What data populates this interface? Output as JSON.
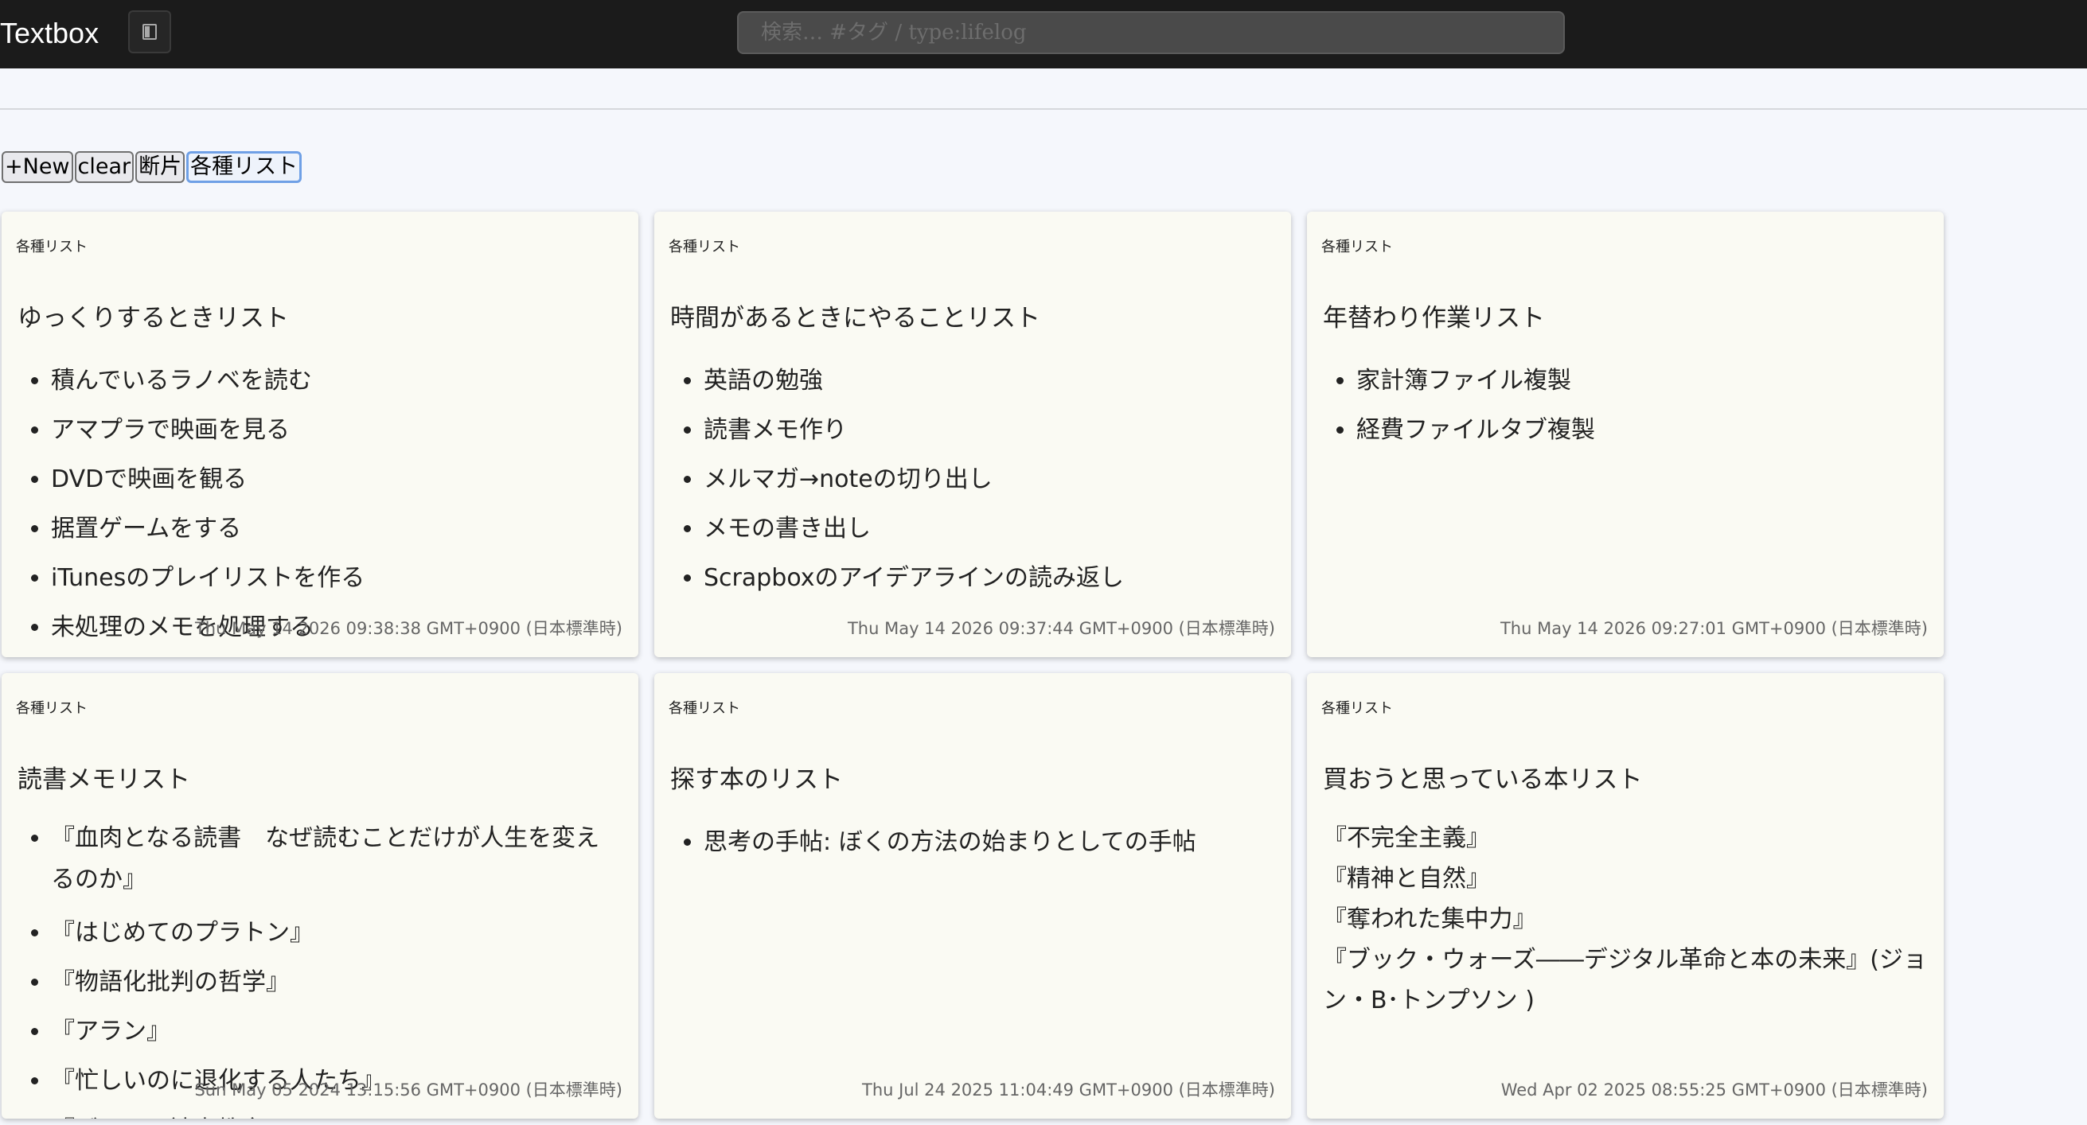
{
  "header": {
    "title": "Textbox",
    "search_placeholder": "検索… #タグ / type:lifelog"
  },
  "toolbar": {
    "new_label": "+New",
    "clear_label": "clear",
    "fragments_label": "断片",
    "lists_label": "各種リスト"
  },
  "cards": [
    {
      "tag": "各種リスト",
      "title": "ゆっくりするときリスト",
      "items": [
        "積んでいるラノベを読む",
        "アマプラで映画を見る",
        "DVDで映画を観る",
        "据置ゲームをする",
        "iTunesのプレイリストを作る",
        "未処理のメモを処理する"
      ],
      "date": "Thu May 14 2026 09:38:38 GMT+0900 (日本標準時)"
    },
    {
      "tag": "各種リスト",
      "title": "時間があるときにやることリスト",
      "items": [
        "英語の勉強",
        "読書メモ作り",
        "メルマガ→noteの切り出し",
        "メモの書き出し",
        "Scrapboxのアイデアラインの読み返し"
      ],
      "date": "Thu May 14 2026 09:37:44 GMT+0900 (日本標準時)"
    },
    {
      "tag": "各種リスト",
      "title": "年替わり作業リスト",
      "items": [
        "家計簿ファイル複製",
        "経費ファイルタブ複製"
      ],
      "date": "Thu May 14 2026 09:27:01 GMT+0900 (日本標準時)"
    },
    {
      "tag": "各種リスト",
      "title": "読書メモリスト",
      "items": [
        "『血肉となる読書　なぜ読むことだけが人生を変えるのか』",
        "『はじめてのプラトン』",
        "『物語化批判の哲学』",
        "『アラン』",
        "『忙しいのに退化する人たち』",
        "『ゾーンと読書教育』"
      ],
      "date": "Sun May 05 2024 13:15:56 GMT+0900 (日本標準時)"
    },
    {
      "tag": "各種リスト",
      "title": "探す本のリスト",
      "items": [
        "思考の手帖: ぼくの方法の始まりとしての手帖"
      ],
      "date": "Thu Jul 24 2025 11:04:49 GMT+0900 (日本標準時)"
    },
    {
      "tag": "各種リスト",
      "title": "買おうと思っている本リスト",
      "lines": [
        "『不完全主義』",
        "『精神と自然』",
        "『奪われた集中力』",
        "『ブック・ウォーズ――デジタル革命と本の未来』(ジョン・B･トンプソン )"
      ],
      "date": "Wed Apr 02 2025 08:55:25 GMT+0900 (日本標準時)"
    }
  ]
}
